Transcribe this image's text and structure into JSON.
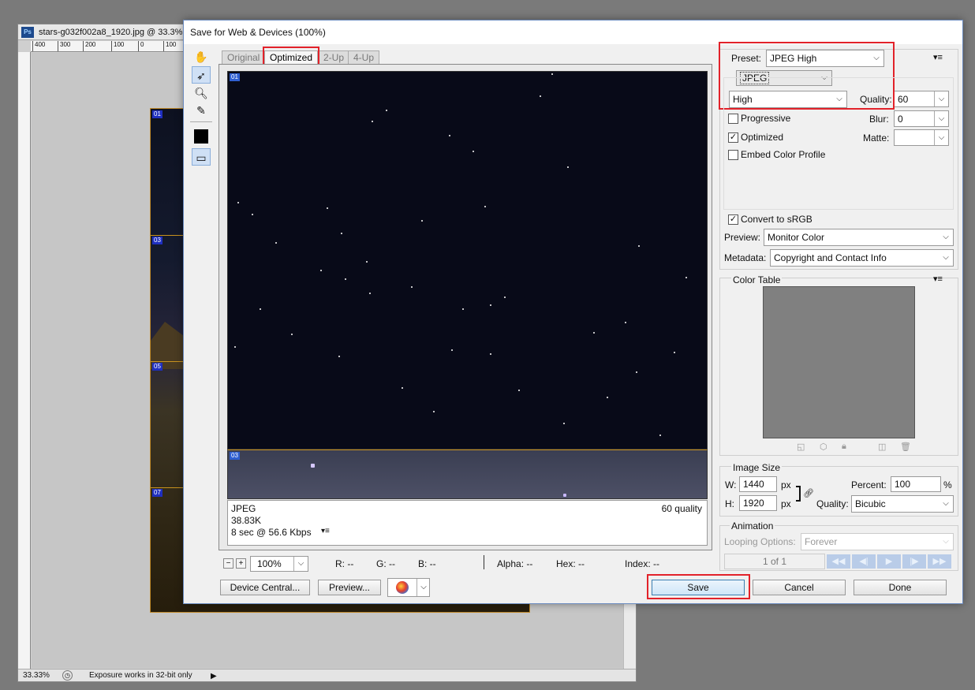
{
  "document": {
    "title": "stars-g032f002a8_1920.jpg @ 33.3%",
    "app_icon": "Ps",
    "ruler_ticks": [
      "400",
      "300",
      "200",
      "100",
      "0",
      "100"
    ],
    "slice_tags": [
      "01",
      "03",
      "05",
      "07"
    ],
    "zoom": "33.33%",
    "status": "Exposure works in 32-bit only"
  },
  "dialog": {
    "title": "Save for Web & Devices (100%)",
    "tabs": [
      "Original",
      "Optimized",
      "2-Up",
      "4-Up"
    ],
    "active_tab": "Optimized",
    "preview_tags": [
      "01",
      "03"
    ],
    "info": {
      "format": "JPEG",
      "size": "38.83K",
      "time": "8 sec @ 56.6 Kbps",
      "quality": "60 quality"
    },
    "zoom": "100%",
    "readouts": {
      "r": "R: --",
      "g": "G: --",
      "b": "B: --",
      "alpha": "Alpha: --",
      "hex": "Hex: --",
      "index": "Index: --"
    },
    "buttons": {
      "device_central": "Device Central...",
      "preview": "Preview...",
      "save": "Save",
      "cancel": "Cancel",
      "done": "Done"
    }
  },
  "settings": {
    "preset_label": "Preset:",
    "preset_value": "JPEG High",
    "format_value": "JPEG",
    "quality_level": "High",
    "quality_label": "Quality:",
    "quality_value": "60",
    "blur_label": "Blur:",
    "blur_value": "0",
    "matte_label": "Matte:",
    "matte_value": "",
    "progressive": "Progressive",
    "optimized": "Optimized",
    "embed_profile": "Embed Color Profile",
    "convert_srgb": "Convert to sRGB",
    "preview_label": "Preview:",
    "preview_value": "Monitor Color",
    "metadata_label": "Metadata:",
    "metadata_value": "Copyright and Contact Info",
    "checked": {
      "progressive": false,
      "optimized": true,
      "embed_profile": false,
      "convert_srgb": true
    }
  },
  "color_table": {
    "title": "Color Table"
  },
  "image_size": {
    "title": "Image Size",
    "w_label": "W:",
    "w_value": "1440",
    "h_label": "H:",
    "h_value": "1920",
    "unit": "px",
    "percent_label": "Percent:",
    "percent_value": "100",
    "percent_unit": "%",
    "quality_label": "Quality:",
    "quality_value": "Bicubic"
  },
  "animation": {
    "title": "Animation",
    "looping_label": "Looping Options:",
    "looping_value": "Forever",
    "frame": "1 of 1"
  },
  "colors": {
    "highlight": "#e2222a",
    "slice": "#c8921f"
  }
}
